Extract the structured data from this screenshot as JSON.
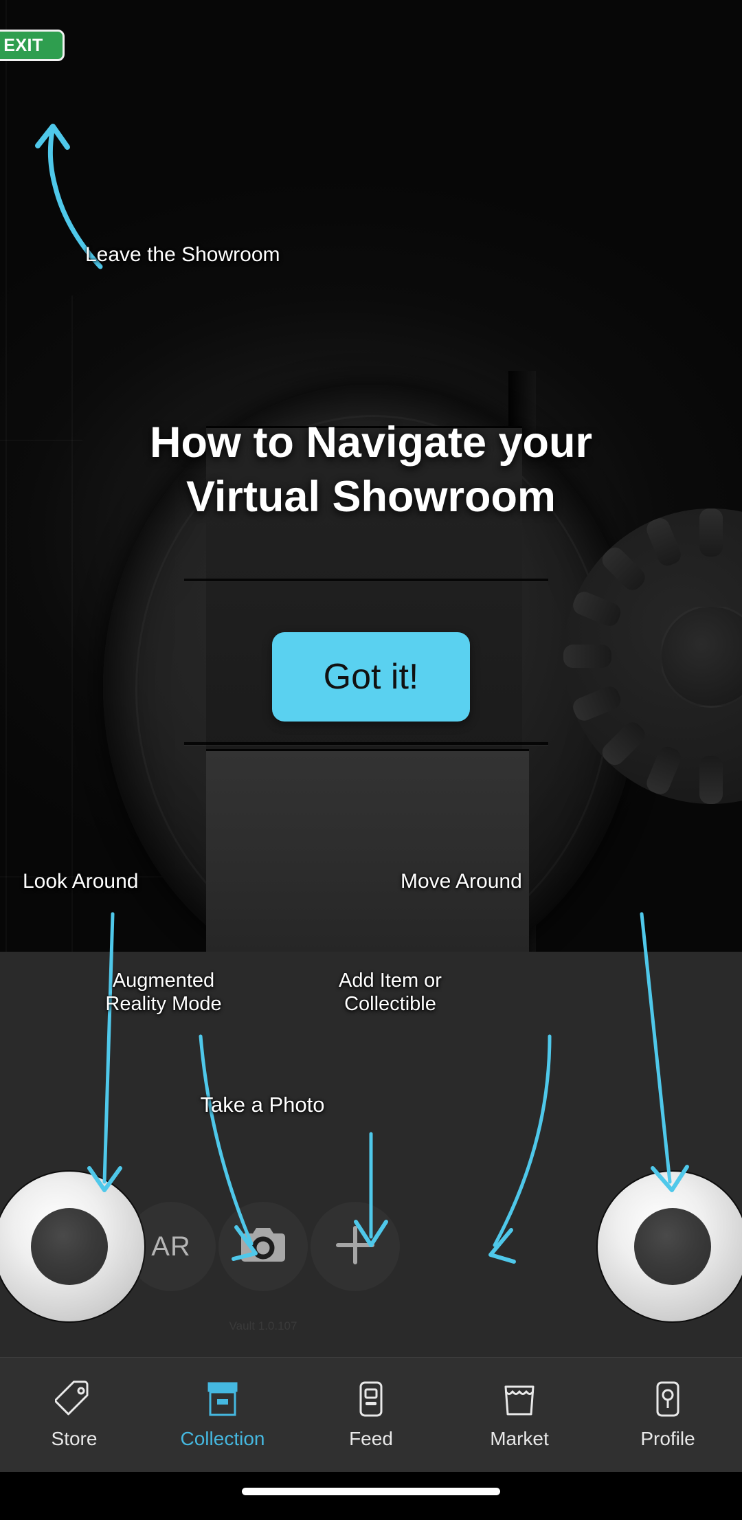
{
  "exit": {
    "label": "EXIT"
  },
  "overlay": {
    "title_line1": "How to Navigate your",
    "title_line2": "Virtual Showroom",
    "cta_label": "Got it!",
    "callouts": {
      "leave": "Leave the Showroom",
      "look_around": "Look Around",
      "move_around": "Move Around",
      "ar_mode": "Augmented\nReality Mode",
      "add_item": "Add Item or\nCollectible",
      "take_photo": "Take a Photo"
    },
    "accent_color": "#4fc8ea"
  },
  "controls": {
    "look_joystick": {
      "name": "Look Around joystick"
    },
    "move_joystick": {
      "name": "Move Around joystick"
    },
    "ar_label": "AR",
    "camera_icon": "camera-icon",
    "add_icon": "plus-icon",
    "version": "Vault 1.0.107"
  },
  "bottom_nav": {
    "active_index": 1,
    "items": [
      {
        "label": "Store",
        "icon": "tag-icon"
      },
      {
        "label": "Collection",
        "icon": "vault-box-icon"
      },
      {
        "label": "Feed",
        "icon": "article-phone-icon"
      },
      {
        "label": "Market",
        "icon": "storefront-icon"
      },
      {
        "label": "Profile",
        "icon": "profile-card-icon"
      }
    ]
  },
  "colors": {
    "exit_green": "#2f9e4f",
    "cta_cyan": "#5ad1f0",
    "nav_active": "#45b8e0",
    "panel_bg": "#2a2a2a",
    "nav_bg": "#303030"
  }
}
